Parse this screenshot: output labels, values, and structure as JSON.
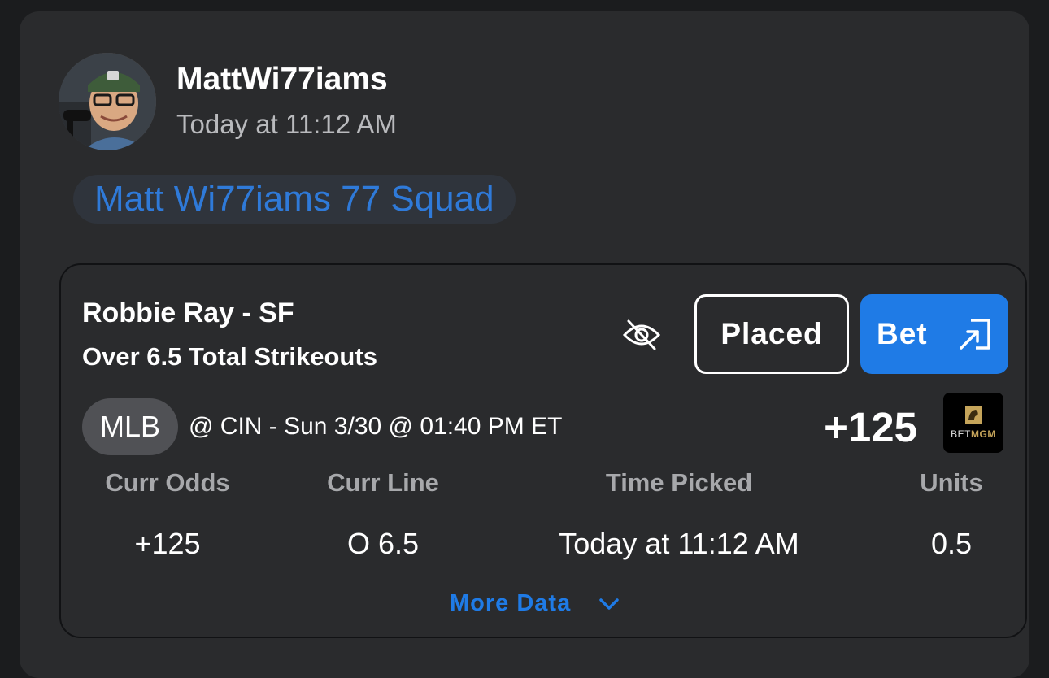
{
  "post": {
    "username": "MattWi77iams",
    "timestamp": "Today at 11:12 AM",
    "squad": "Matt Wi77iams 77 Squad"
  },
  "pick": {
    "player": "Robbie Ray - SF",
    "market": "Over 6.5 Total Strikeouts",
    "placed_label": "Placed",
    "bet_label": "Bet",
    "league": "MLB",
    "game": "@ CIN - Sun 3/30 @ 01:40 PM ET",
    "odds": "+125",
    "sportsbook": {
      "name_prefix": "BET",
      "name_suffix": "MGM"
    }
  },
  "stats": [
    {
      "label": "Curr Odds",
      "value": "+125"
    },
    {
      "label": "Curr Line",
      "value": "O 6.5"
    },
    {
      "label": "Time Picked",
      "value": "Today at 11:12 AM"
    },
    {
      "label": "Units",
      "value": "0.5"
    }
  ],
  "more_data_label": "More Data",
  "colors": {
    "accent_blue": "#1f7be6",
    "squad_text": "#2f7ad9",
    "card_bg": "#2a2b2d",
    "page_bg": "#1b1c1e"
  }
}
